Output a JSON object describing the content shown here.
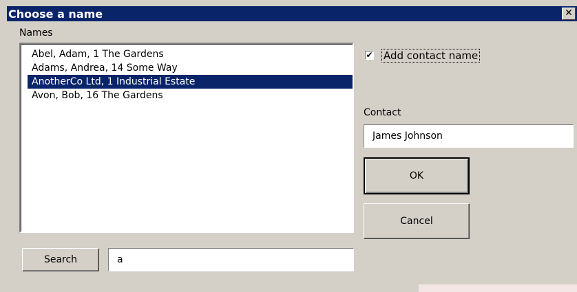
{
  "window": {
    "title": "Choose a name",
    "close_symbol": "✕"
  },
  "names": {
    "label": "Names",
    "items": [
      {
        "label": "Abel, Adam, 1 The Gardens",
        "selected": false
      },
      {
        "label": "Adams, Andrea, 14 Some Way",
        "selected": false
      },
      {
        "label": "AnotherCo Ltd, 1 Industrial Estate",
        "selected": true
      },
      {
        "label": "Avon, Bob, 16 The Gardens",
        "selected": false
      }
    ]
  },
  "add_contact": {
    "label": "Add contact name",
    "checked": true,
    "check_symbol": "✔"
  },
  "contact": {
    "label": "Contact",
    "value": "James Johnson"
  },
  "buttons": {
    "ok": "OK",
    "cancel": "Cancel",
    "search": "Search"
  },
  "search": {
    "value": "a"
  },
  "colors": {
    "dialog_bg": "#d4d0c8",
    "titlebar": "#0a246a",
    "selection": "#0a246a"
  }
}
